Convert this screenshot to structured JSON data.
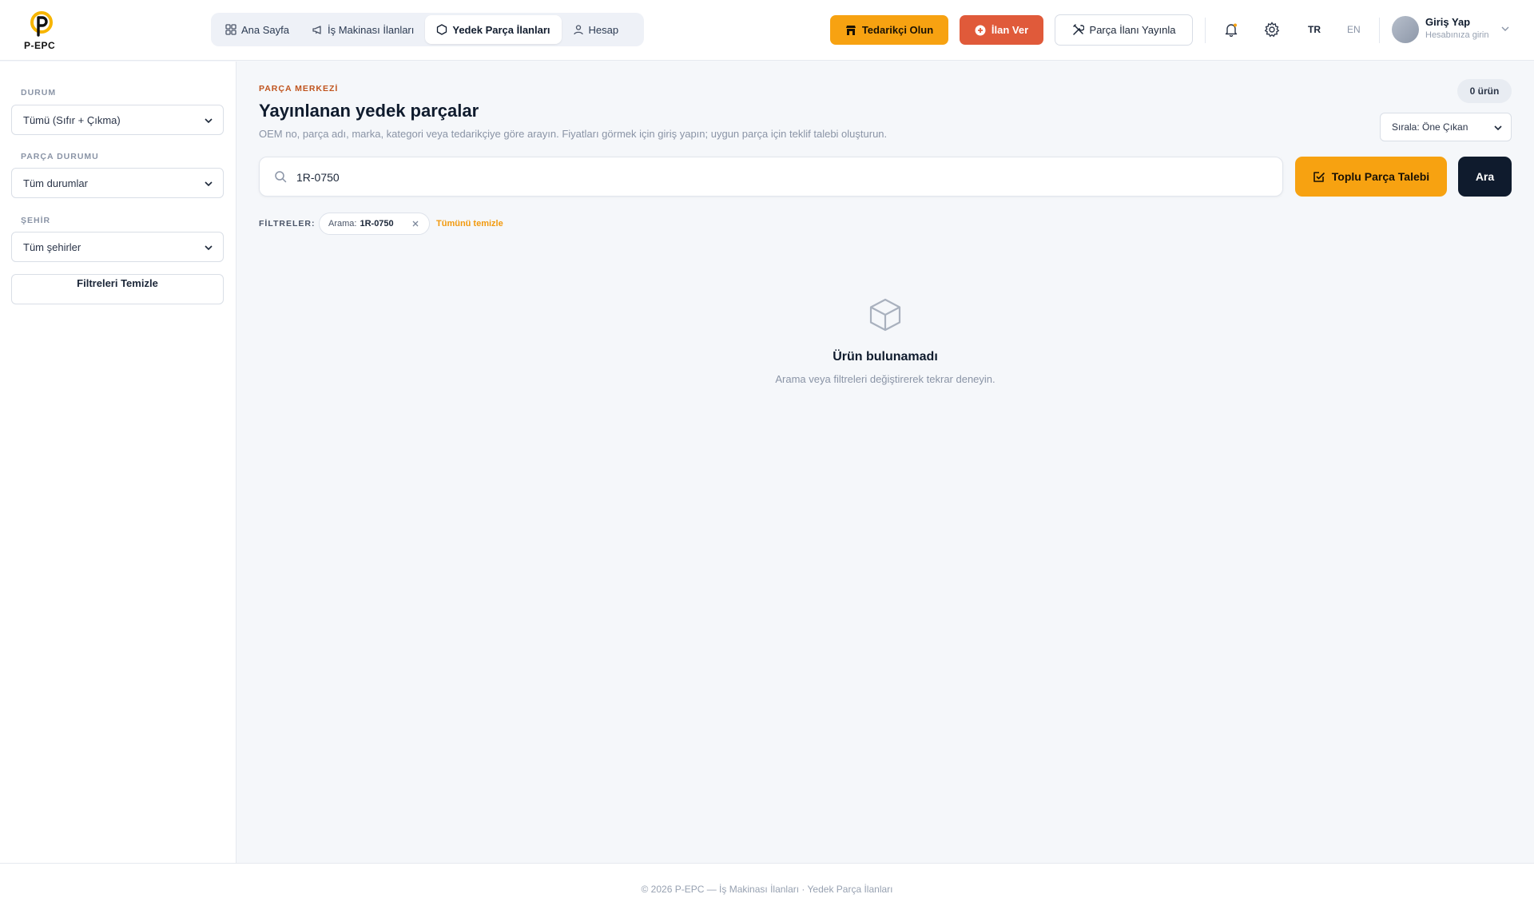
{
  "brand": {
    "logo_text": "P-EPC",
    "accent": "#f7a211",
    "danger": "#e05a3a",
    "dark": "#0f1b2d"
  },
  "nav": {
    "items": [
      {
        "label": "Ana Sayfa",
        "icon": "grid-icon"
      },
      {
        "label": "İş Makinası İlanları",
        "icon": "megaphone-icon"
      },
      {
        "label": "Yedek Parça İlanları",
        "icon": "box-icon",
        "active": true
      },
      {
        "label": "Hesap",
        "icon": "user-icon"
      }
    ]
  },
  "header": {
    "supplier_button": "Tedarikçi Olun",
    "post_ad_button": "İlan Ver",
    "publish_part_button": "Parça İlanı Yayınla",
    "lang_tr": "TR",
    "lang_en": "EN",
    "login_title": "Giriş Yap",
    "login_subtitle": "Hesabınıza girin"
  },
  "sidebar": {
    "status_label": "DURUM",
    "status_value": "Tümü (Sıfır + Çıkma)",
    "part_status_label": "PARÇA DURUMU",
    "part_status_value": "Tüm durumlar",
    "city_label": "ŞEHİR",
    "city_value": "Tüm şehirler",
    "clear_button": "Filtreleri Temizle"
  },
  "main": {
    "eyebrow": "PARÇA MERKEZİ",
    "title": "Yayınlanan yedek parçalar",
    "description": "OEM no, parça adı, marka, kategori veya tedarikçiye göre arayın. Fiyatları görmek için giriş yapın; uygun parça için teklif talebi oluşturun.",
    "count": "0 ürün",
    "sort_value": "Sırala: Öne Çıkan",
    "search_value": "1R-0750",
    "bulk_button": "Toplu Parça Talebi",
    "search_button": "Ara",
    "filters_label": "FİLTRELER:",
    "chip_key": "Arama:",
    "chip_value": "1R-0750",
    "clear_all": "Tümünü temizle",
    "empty_title": "Ürün bulunamadı",
    "empty_subtitle": "Arama veya filtreleri değiştirerek tekrar deneyin."
  },
  "footer": {
    "text": "© 2026 P-EPC — İş Makinası İlanları · Yedek Parça İlanları"
  }
}
